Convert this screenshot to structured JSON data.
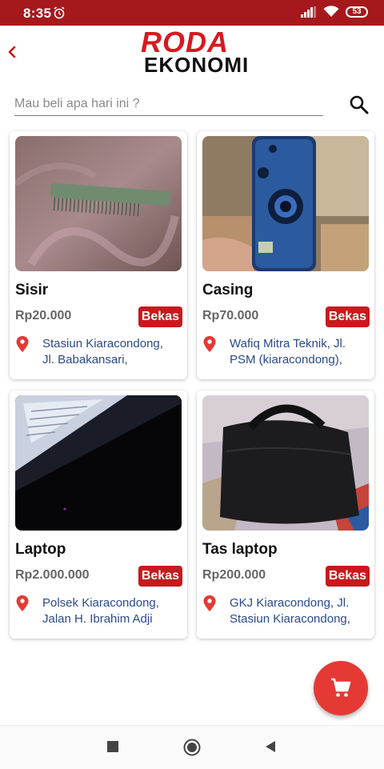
{
  "status_bar": {
    "time": "8:35",
    "battery": "53"
  },
  "header": {
    "logo_line1": "RODA",
    "logo_line2": "EKONOMI"
  },
  "search": {
    "placeholder": "Mau beli apa hari ini ?"
  },
  "products": [
    {
      "title": "Sisir",
      "price": "Rp20.000",
      "condition": "Bekas",
      "location_line1": "Stasiun Kiaracondong,",
      "location_line2": "Jl. Babakansari,"
    },
    {
      "title": "Casing",
      "price": "Rp70.000",
      "condition": "Bekas",
      "location_line1": "Wafiq Mitra Teknik, Jl.",
      "location_line2": "PSM (kiaracondong),"
    },
    {
      "title": "Laptop",
      "price": "Rp2.000.000",
      "condition": "Bekas",
      "location_line1": "Polsek Kiaracondong,",
      "location_line2": "Jalan H. Ibrahim Adji"
    },
    {
      "title": "Tas laptop",
      "price": "Rp200.000",
      "condition": "Bekas",
      "location_line1": "GKJ Kiaracondong, Jl.",
      "location_line2": "Stasiun Kiaracondong,"
    }
  ],
  "colors": {
    "brand_red": "#a5191d",
    "badge_red": "#c8191d",
    "fab_red": "#e53935",
    "location_blue": "#2b4a8b"
  },
  "icons": {
    "back": "chevron-left-icon",
    "search": "search-icon",
    "cart": "cart-icon",
    "pin": "map-pin-icon"
  }
}
